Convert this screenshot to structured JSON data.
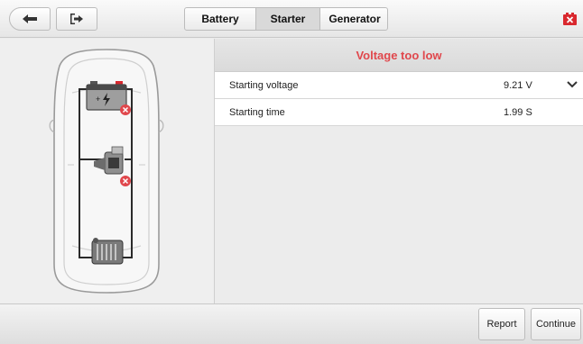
{
  "toolbar": {
    "back_icon": "arrow-left-icon",
    "exit_icon": "exit-icon",
    "tabs": [
      {
        "label": "Battery",
        "active": false
      },
      {
        "label": "Starter",
        "active": true
      },
      {
        "label": "Generator",
        "active": false
      }
    ],
    "close_icon": "close-icon",
    "close_color": "#d9282e"
  },
  "vehicle": {
    "components": [
      {
        "name": "battery",
        "icon": "battery-icon",
        "status": "fault"
      },
      {
        "name": "starter",
        "icon": "starter-motor-icon",
        "status": "fault"
      },
      {
        "name": "generator",
        "icon": "generator-icon",
        "status": "normal"
      }
    ],
    "fault_color": "#e0474c"
  },
  "result": {
    "title": "Voltage too low",
    "title_color": "#e0474c",
    "rows": [
      {
        "label": "Starting voltage",
        "value": "9.21 V",
        "expandable": true
      },
      {
        "label": "Starting time",
        "value": "1.99 S",
        "expandable": false
      }
    ]
  },
  "footer": {
    "report_label": "Report",
    "continue_label": "Continue"
  }
}
